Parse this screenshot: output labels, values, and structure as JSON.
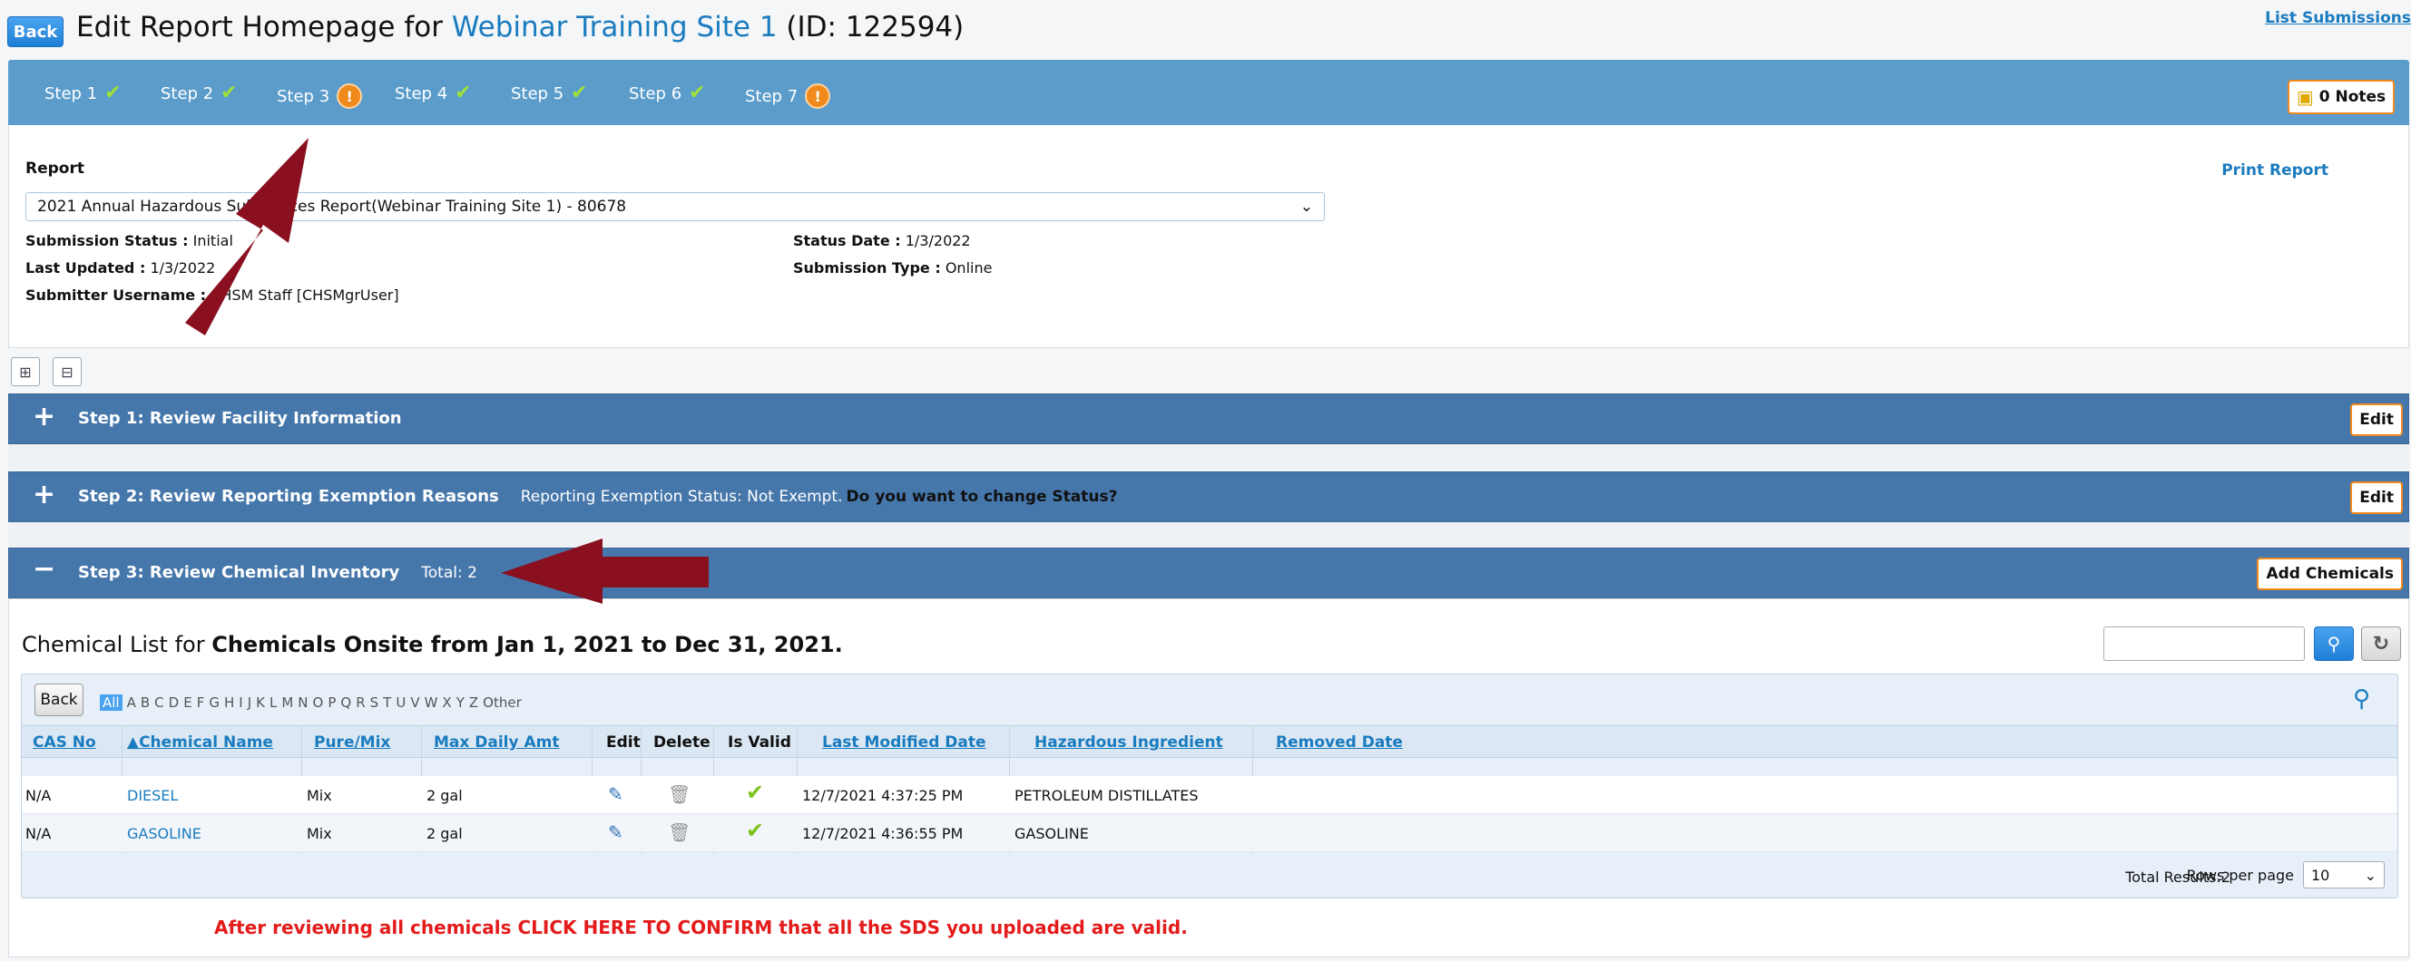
{
  "header": {
    "back_label": "Back",
    "title_prefix": "Edit Report Homepage for",
    "site_name": "Webinar Training Site 1",
    "site_id": "(ID: 122594)",
    "list_submissions": "List Submissions"
  },
  "steps": [
    {
      "label": "Step 1",
      "status": "check"
    },
    {
      "label": "Step 2",
      "status": "check"
    },
    {
      "label": "Step 3",
      "status": "warn"
    },
    {
      "label": "Step 4",
      "status": "check"
    },
    {
      "label": "Step 5",
      "status": "check"
    },
    {
      "label": "Step 6",
      "status": "check"
    },
    {
      "label": "Step 7",
      "status": "warn"
    }
  ],
  "notes_label": "0 Notes",
  "report": {
    "label": "Report",
    "print_label": "Print Report",
    "selected": "2021 Annual Hazardous Substances Report(Webinar Training Site 1) - 80678",
    "submission_status_label": "Submission Status :",
    "submission_status_value": "Initial",
    "last_updated_label": "Last Updated :",
    "last_updated_value": "1/3/2022",
    "submitter_label": "Submitter Username :",
    "submitter_value": "CHSM Staff [CHSMgrUser]",
    "status_date_label": "Status Date :",
    "status_date_value": "1/3/2022",
    "submission_type_label": "Submission Type :",
    "submission_type_value": "Online"
  },
  "sections": {
    "step1": {
      "title": "Step 1: Review Facility Information",
      "button": "Edit"
    },
    "step2": {
      "title": "Step 2: Review Reporting Exemption Reasons",
      "status": "Reporting Exemption Status: Not Exempt.",
      "question": "Do you want to change Status?",
      "button": "Edit"
    },
    "step3": {
      "title": "Step 3: Review Chemical Inventory",
      "total": "Total: 2",
      "button": "Add Chemicals"
    }
  },
  "inventory": {
    "list_prefix": "Chemical List for",
    "list_range": "Chemicals Onsite from Jan 1, 2021 to Dec 31, 2021.",
    "grid_back": "Back",
    "alphabet": [
      "All",
      "A",
      "B",
      "C",
      "D",
      "E",
      "F",
      "G",
      "H",
      "I",
      "J",
      "K",
      "L",
      "M",
      "N",
      "O",
      "P",
      "Q",
      "R",
      "S",
      "T",
      "U",
      "V",
      "W",
      "X",
      "Y",
      "Z",
      "Other"
    ],
    "columns": {
      "cas": "CAS No",
      "name": "Chemical Name",
      "pure": "Pure/Mix",
      "max": "Max Daily Amt",
      "edit": "Edit",
      "delete": "Delete",
      "valid": "Is Valid",
      "modified": "Last Modified Date",
      "ingredient": "Hazardous Ingredient",
      "removed": "Removed Date"
    },
    "rows": [
      {
        "cas": "N/A",
        "name": "DIESEL",
        "pure": "Mix",
        "max": "2 gal",
        "modified": "12/7/2021 4:37:25 PM",
        "ingredient": "PETROLEUM DISTILLATES",
        "removed": ""
      },
      {
        "cas": "N/A",
        "name": "GASOLINE",
        "pure": "Mix",
        "max": "2 gal",
        "modified": "12/7/2021 4:36:55 PM",
        "ingredient": "GASOLINE",
        "removed": ""
      }
    ],
    "total_results": "Total Results:2",
    "rows_per_page_label": "Rows per page",
    "rows_per_page_value": "10",
    "confirm_text": "After reviewing all chemicals CLICK HERE TO CONFIRM that all the SDS you uploaded are valid."
  },
  "colors": {
    "step_bar": "#5b9ccb",
    "section_bar": "#4677ab",
    "accent_orange": "#f08a1c",
    "link": "#1a7bbf",
    "annotation_arrow": "#8a1020"
  }
}
